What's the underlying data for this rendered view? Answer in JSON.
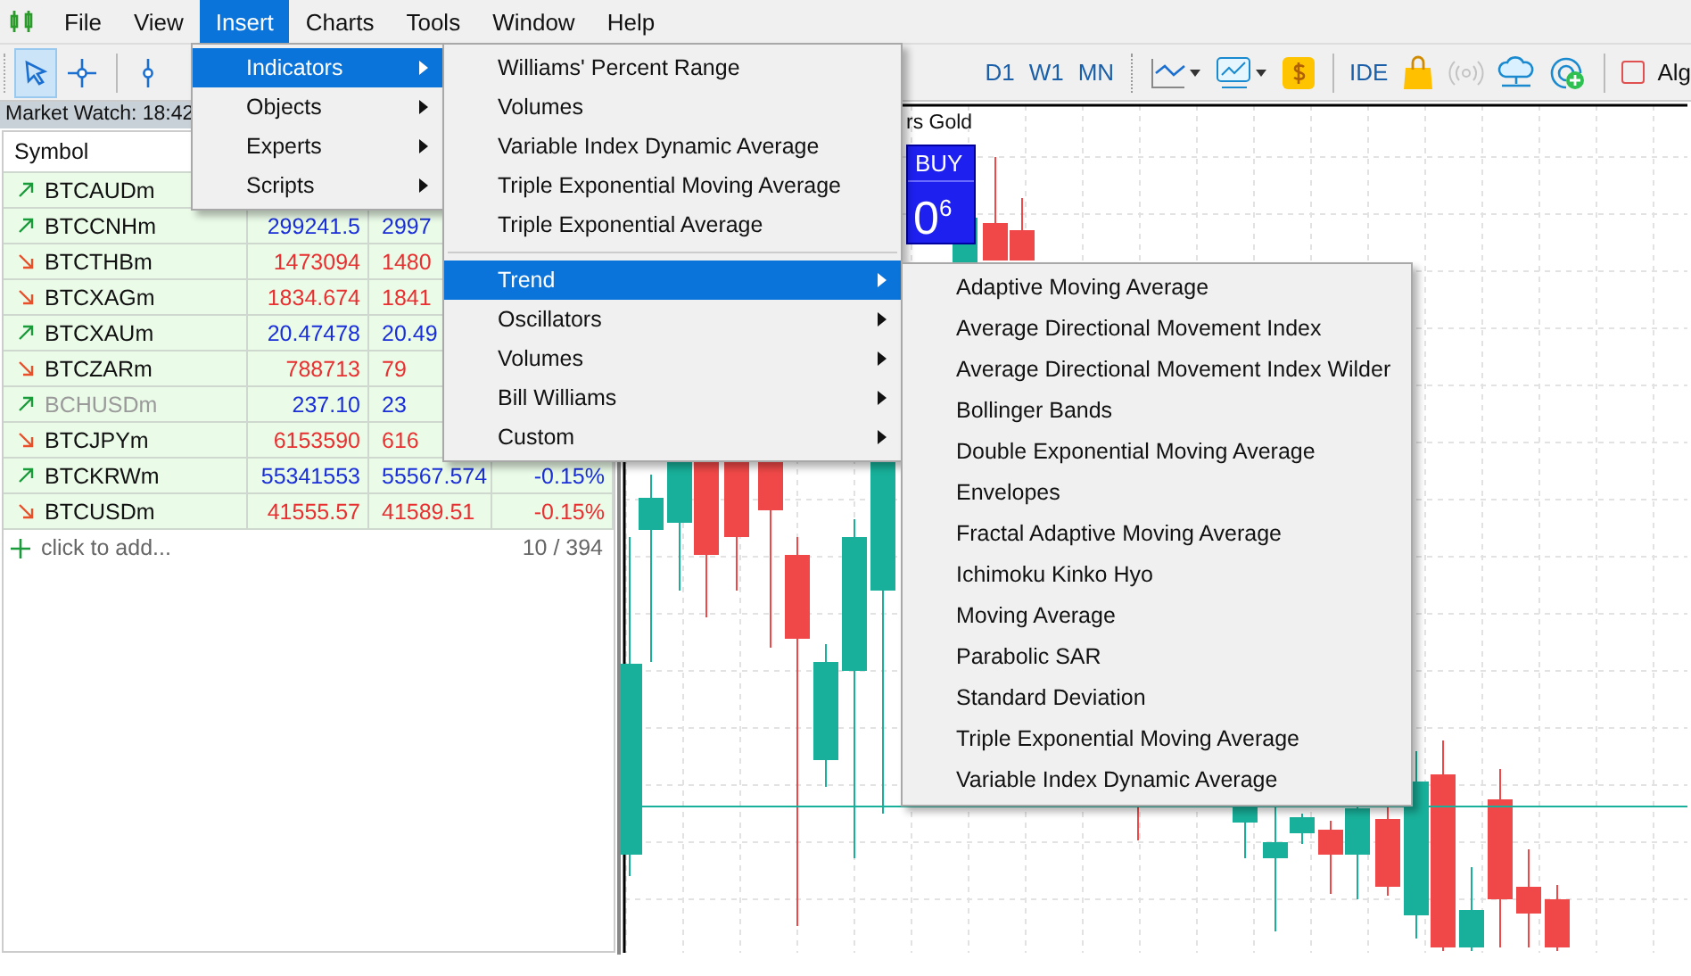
{
  "menu_bar": [
    {
      "label": "File",
      "selected": false
    },
    {
      "label": "View",
      "selected": false
    },
    {
      "label": "Insert",
      "selected": true
    },
    {
      "label": "Charts",
      "selected": false
    },
    {
      "label": "Tools",
      "selected": false
    },
    {
      "label": "Window",
      "selected": false
    },
    {
      "label": "Help",
      "selected": false
    }
  ],
  "toolbar": {
    "tools": [
      {
        "kind": "select",
        "selected": true
      },
      {
        "kind": "crosshair",
        "selected": false
      },
      {
        "kind": "vline",
        "selected": false
      }
    ],
    "timeframes": [
      "D1",
      "W1",
      "MN"
    ],
    "right_tools": [
      {
        "kind": "chart_type",
        "disabled": false
      },
      {
        "kind": "indicator_list",
        "disabled": false
      },
      {
        "kind": "market",
        "disabled": false
      },
      {
        "kind": "ide",
        "label": "IDE",
        "disabled": false
      },
      {
        "kind": "shop",
        "disabled": false
      },
      {
        "kind": "signals",
        "disabled": true
      },
      {
        "kind": "cloud",
        "disabled": false
      },
      {
        "kind": "radar",
        "disabled": false
      }
    ],
    "algo": {
      "label": "Alg",
      "checked": false
    }
  },
  "market_watch": {
    "title": "Market Watch: 18:42",
    "header": "Symbol",
    "rows": [
      {
        "symbol": "BTCAUDm",
        "rising": true,
        "disabled": false
      },
      {
        "symbol": "BTCCNHm",
        "rising": true,
        "disabled": false,
        "bid": "299241.5",
        "ask": "2997"
      },
      {
        "symbol": "BTCTHBm",
        "rising": false,
        "disabled": false,
        "bid": "1473094",
        "ask": "1480"
      },
      {
        "symbol": "BTCXAGm",
        "rising": false,
        "disabled": false,
        "bid": "1834.674",
        "ask": "1841"
      },
      {
        "symbol": "BTCXAUm",
        "rising": true,
        "disabled": false,
        "bid": "20.47478",
        "ask": "20.49"
      },
      {
        "symbol": "BTCZARm",
        "rising": false,
        "disabled": false,
        "bid": "788713",
        "ask": "79"
      },
      {
        "symbol": "BCHUSDm",
        "rising": true,
        "disabled": true,
        "bid": "237.10",
        "ask": "23"
      },
      {
        "symbol": "BTCJPYm",
        "rising": false,
        "disabled": false,
        "bid": "6153590",
        "ask": "616"
      },
      {
        "symbol": "BTCKRWm",
        "rising": true,
        "disabled": false,
        "bid": "55341553",
        "ask": "55567.574",
        "change": "-0.15%"
      },
      {
        "symbol": "BTCUSDm",
        "rising": false,
        "disabled": false,
        "bid": "41555.57",
        "ask": "41589.51",
        "change": "-0.15%"
      }
    ],
    "add_label": "click to add...",
    "count": "10 / 394"
  },
  "chart": {
    "title": "rs Gold",
    "buy_label": "BUY",
    "price": "0$^{6}$"
  },
  "insert_menu": [
    {
      "label": "Indicators",
      "selected": true
    },
    {
      "label": "Objects",
      "selected": false
    },
    {
      "label": "Experts",
      "selected": false
    },
    {
      "label": "Scripts",
      "selected": false
    }
  ],
  "indicators_menu": {
    "recent": [
      "Williams' Percent Range",
      "Volumes",
      "Variable Index Dynamic Average",
      "Triple Exponential Moving Average",
      "Triple Exponential Average"
    ],
    "categories": [
      {
        "label": "Trend",
        "selected": true
      },
      {
        "label": "Oscillators",
        "selected": false
      },
      {
        "label": "Volumes",
        "selected": false
      },
      {
        "label": "Bill Williams",
        "selected": false
      },
      {
        "label": "Custom",
        "selected": false
      }
    ]
  },
  "trend_menu": [
    "Adaptive Moving Average",
    "Average Directional Movement Index",
    "Average Directional Movement Index Wilder",
    "Bollinger Bands",
    "Double Exponential Moving Average",
    "Envelopes",
    "Fractal Adaptive Moving Average",
    "Ichimoku Kinko Hyo",
    "Moving Average",
    "Parabolic SAR",
    "Standard Deviation",
    "Triple Exponential Moving Average",
    "Variable Index Dynamic Average"
  ]
}
